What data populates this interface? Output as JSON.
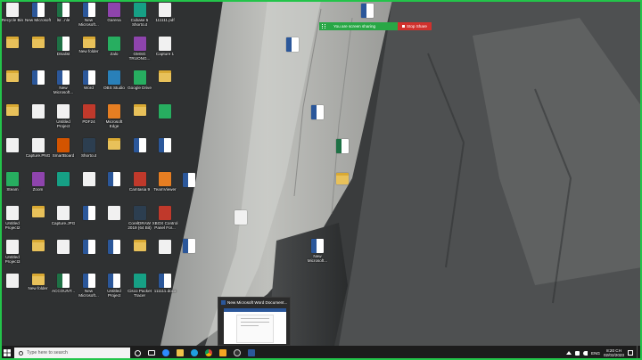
{
  "sharing": {
    "status_text": "You are screen sharing",
    "stop_label": "Stop Share",
    "status_color": "#28a745",
    "stop_color": "#d0312d"
  },
  "desktop_icons": [
    {
      "label": "Recycle Bin",
      "type": "white"
    },
    {
      "label": "New Microsoft",
      "type": "word"
    },
    {
      "label": "lsr...nle",
      "type": "excel"
    },
    {
      "label": "New Microsoft...",
      "type": "word"
    },
    {
      "label": "Garena",
      "type": "app"
    },
    {
      "label": "Cubase 5 Shortcut",
      "type": "app"
    },
    {
      "label": "111111.pdf",
      "type": "white"
    },
    {
      "label": "",
      "type": "folder"
    },
    {
      "label": "",
      "type": "folder"
    },
    {
      "label": "DSalist",
      "type": "excel"
    },
    {
      "label": "New folder",
      "type": "folder"
    },
    {
      "label": "Zalo",
      "type": "app"
    },
    {
      "label": "GMSG TRUONG...",
      "type": "app"
    },
    {
      "label": "Capture 1",
      "type": "white"
    },
    {
      "label": "",
      "type": "folder"
    },
    {
      "label": "",
      "type": "word"
    },
    {
      "label": "New Microsoft...",
      "type": "word"
    },
    {
      "label": "Word",
      "type": "word"
    },
    {
      "label": "OBS Studio",
      "type": "app"
    },
    {
      "label": "Google Drive",
      "type": "app"
    },
    {
      "label": "",
      "type": "folder"
    },
    {
      "label": "",
      "type": "folder"
    },
    {
      "label": "",
      "type": "white"
    },
    {
      "label": "Untitled Project",
      "type": "white"
    },
    {
      "label": "PDF24",
      "type": "app"
    },
    {
      "label": "Microsoft Edge",
      "type": "app"
    },
    {
      "label": "",
      "type": "folder"
    },
    {
      "label": "",
      "type": "app"
    },
    {
      "label": "",
      "type": "white"
    },
    {
      "label": "Capture.PNG",
      "type": "white"
    },
    {
      "label": "SmartBoard",
      "type": "app"
    },
    {
      "label": "Shortcut",
      "type": "app"
    },
    {
      "label": "",
      "type": "folder"
    },
    {
      "label": "",
      "type": "word"
    },
    {
      "label": "",
      "type": "word"
    },
    {
      "label": "Steam",
      "type": "app"
    },
    {
      "label": "Zoom",
      "type": "app"
    },
    {
      "label": "",
      "type": "app"
    },
    {
      "label": "",
      "type": "white"
    },
    {
      "label": "",
      "type": "word"
    },
    {
      "label": "Camtasia 9",
      "type": "app"
    },
    {
      "label": "TeamViewer",
      "type": "app"
    },
    {
      "label": "Untitled Project2",
      "type": "white"
    },
    {
      "label": "",
      "type": "folder"
    },
    {
      "label": "Capture.JPG",
      "type": "white"
    },
    {
      "label": "",
      "type": "word"
    },
    {
      "label": "",
      "type": "white"
    },
    {
      "label": "CorelDRAW 2019 (64 Bit)",
      "type": "app"
    },
    {
      "label": "XBOX Control Panel For...",
      "type": "app"
    },
    {
      "label": "Untitled Project3",
      "type": "white"
    },
    {
      "label": "",
      "type": "folder"
    },
    {
      "label": "",
      "type": "white"
    },
    {
      "label": "",
      "type": "word"
    },
    {
      "label": "",
      "type": "word"
    },
    {
      "label": "",
      "type": "folder"
    },
    {
      "label": "",
      "type": "white"
    },
    {
      "label": "",
      "type": "white"
    },
    {
      "label": "New folder",
      "type": "folder"
    },
    {
      "label": "ACCOUNT...",
      "type": "excel"
    },
    {
      "label": "New Microsoft...",
      "type": "word"
    },
    {
      "label": "Untitled Project",
      "type": "word"
    },
    {
      "label": "Cisco Packet Tracer",
      "type": "app"
    },
    {
      "label": "111111.docx",
      "type": "word"
    },
    {
      "label": "",
      "type": "word"
    },
    {
      "label": "",
      "type": "word"
    },
    {
      "label": "",
      "type": "word"
    },
    {
      "label": "",
      "type": "excel"
    },
    {
      "label": "",
      "type": "white"
    },
    {
      "label": "",
      "type": "white"
    },
    {
      "label": "",
      "type": "word"
    },
    {
      "label": "New Microsoft...",
      "type": "word"
    }
  ],
  "preview": {
    "title": "New Microsoft Word Document..."
  },
  "taskbar": {
    "search_placeholder": "Type here to search",
    "language": "ENG",
    "time": "8:20 CH",
    "date": "02/02/2023"
  }
}
